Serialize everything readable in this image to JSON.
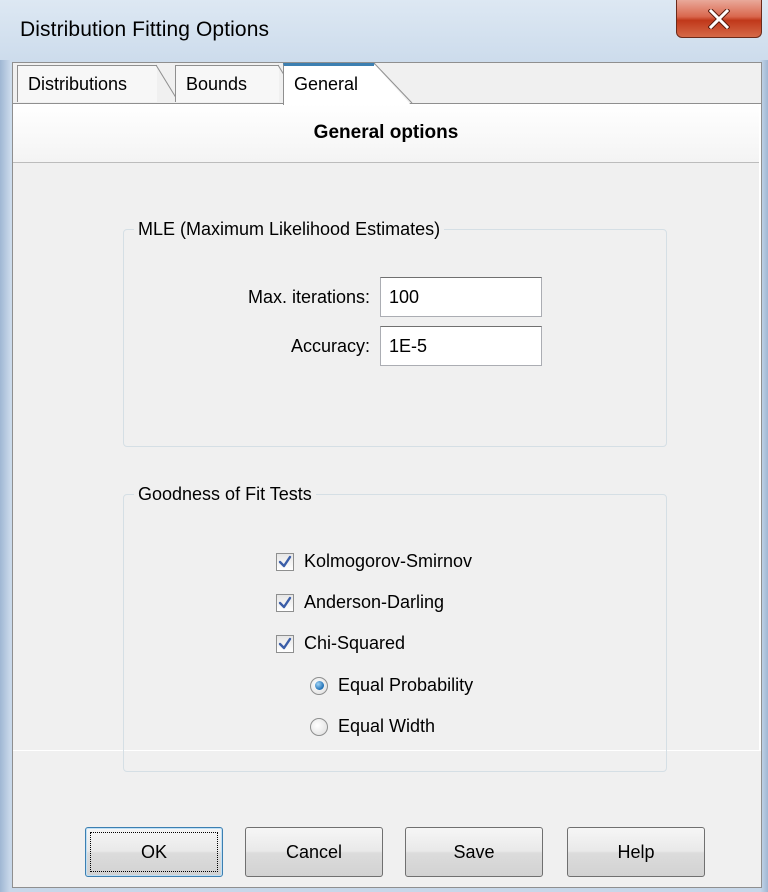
{
  "window": {
    "title": "Distribution Fitting Options"
  },
  "tabs": [
    {
      "label": "Distributions",
      "active": false
    },
    {
      "label": "Bounds",
      "active": false
    },
    {
      "label": "General",
      "active": true
    }
  ],
  "panel": {
    "header": "General options"
  },
  "mle": {
    "legend": "MLE (Maximum Likelihood Estimates)",
    "max_iterations_label": "Max. iterations:",
    "max_iterations_value": "100",
    "accuracy_label": "Accuracy:",
    "accuracy_value": "1E-5"
  },
  "gof": {
    "legend": "Goodness of Fit Tests",
    "checks": [
      {
        "label": "Kolmogorov-Smirnov",
        "checked": true
      },
      {
        "label": "Anderson-Darling",
        "checked": true
      },
      {
        "label": "Chi-Squared",
        "checked": true
      }
    ],
    "radios": [
      {
        "label": "Equal Probability",
        "selected": true
      },
      {
        "label": "Equal Width",
        "selected": false
      }
    ]
  },
  "buttons": {
    "ok": "OK",
    "cancel": "Cancel",
    "save": "Save",
    "help": "Help"
  },
  "icons": {
    "close": "close-icon",
    "check": "checkmark-icon"
  },
  "colors": {
    "accent": "#3c7fb1",
    "close_button": "#c7462a"
  }
}
